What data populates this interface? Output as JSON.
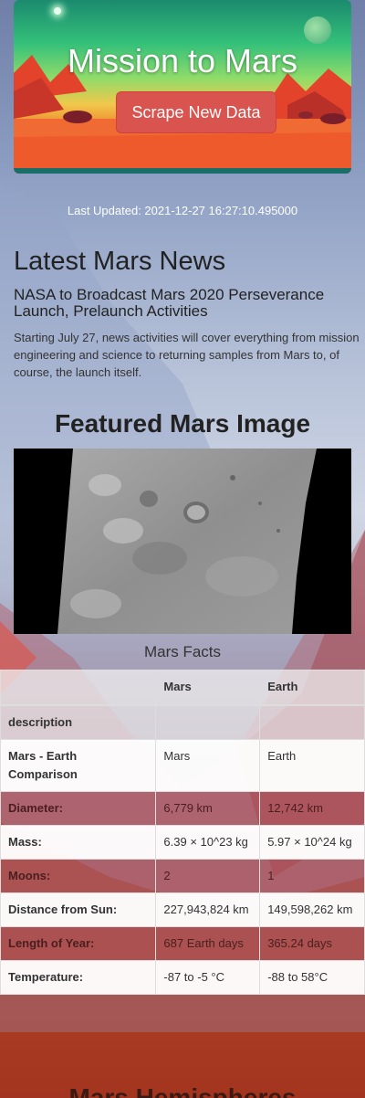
{
  "header": {
    "title": "Mission to Mars",
    "scrape_button_label": "Scrape New Data"
  },
  "last_updated": "Last Updated: 2021-12-27 16:27:10.495000",
  "news": {
    "heading": "Latest Mars News",
    "title": "NASA to Broadcast Mars 2020 Perseverance Launch, Prelaunch Activities",
    "paragraph": "Starting July 27, news activities will cover everything from mission engineering and science to returning samples from Mars to, of course, the launch itself."
  },
  "featured": {
    "heading": "Featured Mars Image"
  },
  "facts": {
    "caption": "Mars Facts",
    "columns": [
      "",
      "Mars",
      "Earth"
    ],
    "index_label": "description",
    "rows": [
      {
        "label": "Mars - Earth Comparison",
        "mars": "Mars",
        "earth": "Earth"
      },
      {
        "label": "Diameter:",
        "mars": "6,779 km",
        "earth": "12,742 km"
      },
      {
        "label": "Mass:",
        "mars": "6.39 × 10^23 kg",
        "earth": "5.97 × 10^24 kg"
      },
      {
        "label": "Moons:",
        "mars": "2",
        "earth": "1"
      },
      {
        "label": "Distance from Sun:",
        "mars": "227,943,824 km",
        "earth": "149,598,262 km"
      },
      {
        "label": "Length of Year:",
        "mars": "687 Earth days",
        "earth": "365.24 days"
      },
      {
        "label": "Temperature:",
        "mars": "-87 to -5 °C",
        "earth": "-88 to 58°C"
      }
    ]
  },
  "hemispheres": {
    "heading": "Mars Hemispheres"
  },
  "colors": {
    "scrape_button": "#d9534f",
    "table_dark_row": "#be4646"
  }
}
